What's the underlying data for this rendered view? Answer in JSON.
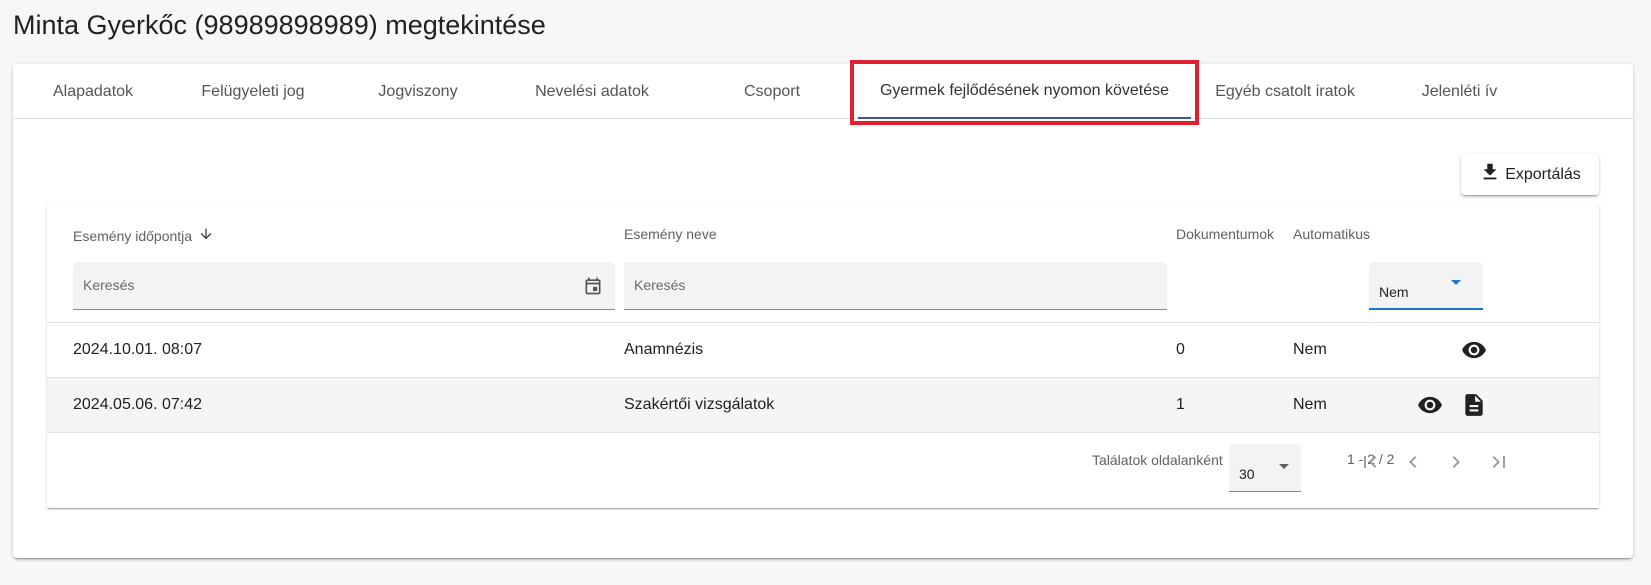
{
  "page": {
    "title": "Minta Gyerkőc (98989898989) megtekintése"
  },
  "tabs": [
    {
      "label": "Alapadatok",
      "active": false
    },
    {
      "label": "Felügyeleti jog",
      "active": false
    },
    {
      "label": "Jogviszony",
      "active": false
    },
    {
      "label": "Nevelési adatok",
      "active": false
    },
    {
      "label": "Csoport",
      "active": false
    },
    {
      "label": "Gyermek fejlődésének nyomon követése",
      "active": true
    },
    {
      "label": "Egyéb csatolt iratok",
      "active": false
    },
    {
      "label": "Jelenléti ív",
      "active": false
    }
  ],
  "toolbar": {
    "export_label": "Exportálás",
    "export_icon": "download-icon"
  },
  "table": {
    "columns": {
      "date": "Esemény időpontja",
      "name": "Esemény neve",
      "docs": "Dokumentumok",
      "auto": "Automatikus"
    },
    "sort_icon": "arrow-down-icon",
    "filters": {
      "date_placeholder": "Keresés",
      "name_placeholder": "Keresés",
      "auto_value": "Nem"
    },
    "rows": [
      {
        "date": "2024.10.01. 08:07",
        "name": "Anamnézis",
        "docs": "0",
        "auto": "Nem",
        "actions": [
          "eye-icon"
        ]
      },
      {
        "date": "2024.05.06. 07:42",
        "name": "Szakértői vizsgálatok",
        "docs": "1",
        "auto": "Nem",
        "actions": [
          "eye-icon",
          "document-icon"
        ]
      }
    ]
  },
  "pagination": {
    "per_page_label": "Találatok oldalanként",
    "per_page_value": "30",
    "range": "1 - 2 / 2"
  },
  "colors": {
    "highlight_border": "#e0202e",
    "accent": "#1976d2",
    "tab_indicator": "#3f51b5"
  }
}
